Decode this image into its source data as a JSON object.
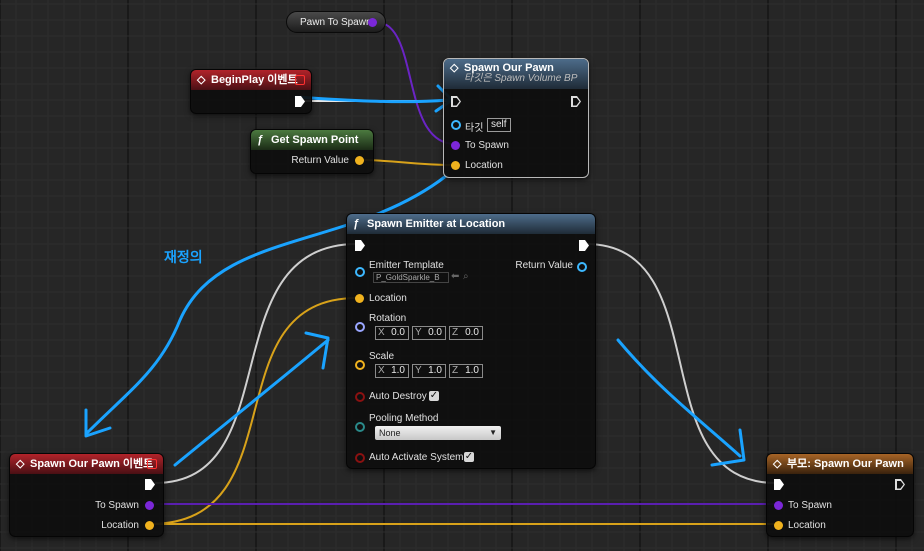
{
  "colors": {
    "background": "#262626",
    "exec": "#ffffff",
    "object_pin": "#7b27d8",
    "vector_pin": "#f0b21e",
    "rotator_pin": "#9aa6ff",
    "bool_pin": "#8a1111",
    "annotation": "#1aa3ff"
  },
  "nodes": {
    "pawn_to_spawn": {
      "label": "Pawn To Spawn"
    },
    "begin_play": {
      "title": "BeginPlay 이벤트",
      "icon": "diamond-icon"
    },
    "spawn_our_pawn_call": {
      "title": "Spawn Our Pawn",
      "subtitle": "타깃은 Spawn Volume BP",
      "target_label": "타깃",
      "target_value": "self",
      "to_spawn_label": "To Spawn",
      "location_label": "Location"
    },
    "get_spawn_point": {
      "title": "Get Spawn Point",
      "icon": "function-icon",
      "return_label": "Return Value"
    },
    "spawn_emitter": {
      "title": "Spawn Emitter at Location",
      "icon": "function-icon",
      "emitter_template_label": "Emitter Template",
      "emitter_template_value": "P_GoldSparkle_B",
      "return_label": "Return Value",
      "location_label": "Location",
      "rotation_label": "Rotation",
      "rotation": [
        {
          "axis": "X",
          "value": "0.0"
        },
        {
          "axis": "Y",
          "value": "0.0"
        },
        {
          "axis": "Z",
          "value": "0.0"
        }
      ],
      "scale_label": "Scale",
      "scale": [
        {
          "axis": "X",
          "value": "1.0"
        },
        {
          "axis": "Y",
          "value": "1.0"
        },
        {
          "axis": "Z",
          "value": "1.0"
        }
      ],
      "auto_destroy_label": "Auto Destroy",
      "auto_destroy": true,
      "pooling_method_label": "Pooling Method",
      "pooling_method_value": "None",
      "auto_activate_label": "Auto Activate System",
      "auto_activate": true
    },
    "spawn_our_pawn_event": {
      "title": "Spawn Our Pawn 이벤트",
      "to_spawn_label": "To Spawn",
      "location_label": "Location"
    },
    "parent_spawn_our_pawn": {
      "title": "부모: Spawn Our Pawn",
      "to_spawn_label": "To Spawn",
      "location_label": "Location"
    }
  },
  "annotation": {
    "text": "재정의"
  }
}
